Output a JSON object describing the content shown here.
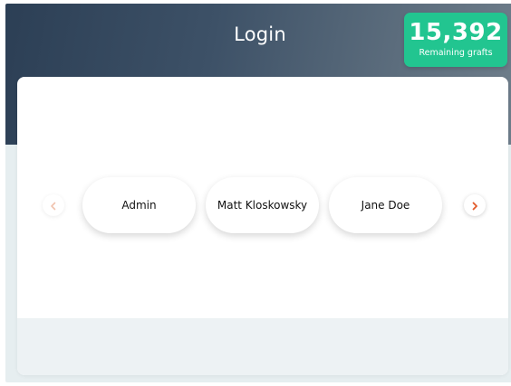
{
  "header": {
    "title": "Login"
  },
  "counter": {
    "value": "15,392",
    "label": "Remaining grafts"
  },
  "carousel": {
    "prev_icon": "chevron-left-icon",
    "next_icon": "chevron-right-icon",
    "users": [
      {
        "name": "Admin"
      },
      {
        "name": "Matt Kloskowsky"
      },
      {
        "name": "Jane Doe"
      }
    ]
  },
  "colors": {
    "header_gradient_start": "#2c3f55",
    "header_gradient_end": "#6f7e8b",
    "counter_bg": "#22c590",
    "arrow_active": "#e25a2b",
    "arrow_disabled": "#f1c3ae",
    "page_bg": "#e6eef0"
  }
}
